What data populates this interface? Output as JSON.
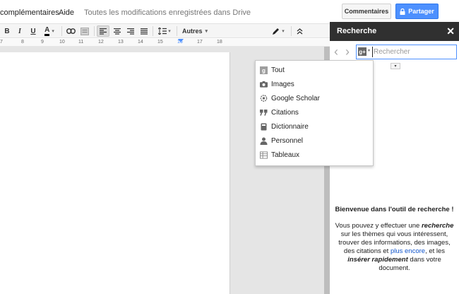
{
  "menu": {
    "addons": "complémentaires",
    "help": "Aide",
    "save_status": "Toutes les modifications enregistrées dans Drive",
    "comments_button": "Commentaires",
    "share_button": "Partager"
  },
  "toolbar": {
    "bold": "B",
    "italic": "I",
    "underline": "U",
    "text_color": "A",
    "more": "Autres",
    "dropdown_arrow": "▾"
  },
  "ruler": {
    "ticks": [
      "7",
      "8",
      "9",
      "10",
      "11",
      "12",
      "13",
      "14",
      "15",
      "16",
      "17",
      "18"
    ]
  },
  "panel": {
    "title": "Recherche",
    "close": "✕",
    "back": "‹",
    "forward": "›",
    "search_placeholder": "Rechercher",
    "search_value": "",
    "filter_toggle": "▾",
    "welcome_title": "Bienvenue dans l'outil de recherche !",
    "welcome_p1": "Vous pouvez y effectuer une",
    "welcome_em1": "recherche",
    "welcome_p2": "sur les thèmes qui vous intéressent, trouver des informations, des images, des citations et",
    "welcome_link": "plus encore",
    "welcome_p3": ", et les",
    "welcome_em2": "insérer rapidement",
    "welcome_p4": "dans votre document."
  },
  "search_types": {
    "items": [
      {
        "label": "Tout",
        "icon": "google-icon"
      },
      {
        "label": "Images",
        "icon": "camera-icon"
      },
      {
        "label": "Google Scholar",
        "icon": "scholar-icon"
      },
      {
        "label": "Citations",
        "icon": "quote-icon"
      },
      {
        "label": "Dictionnaire",
        "icon": "book-icon"
      },
      {
        "label": "Personnel",
        "icon": "person-icon"
      },
      {
        "label": "Tableaux",
        "icon": "table-icon"
      }
    ]
  },
  "colors": {
    "accent": "#4d90fe",
    "panel_header": "#303030",
    "link": "#1155cc"
  }
}
